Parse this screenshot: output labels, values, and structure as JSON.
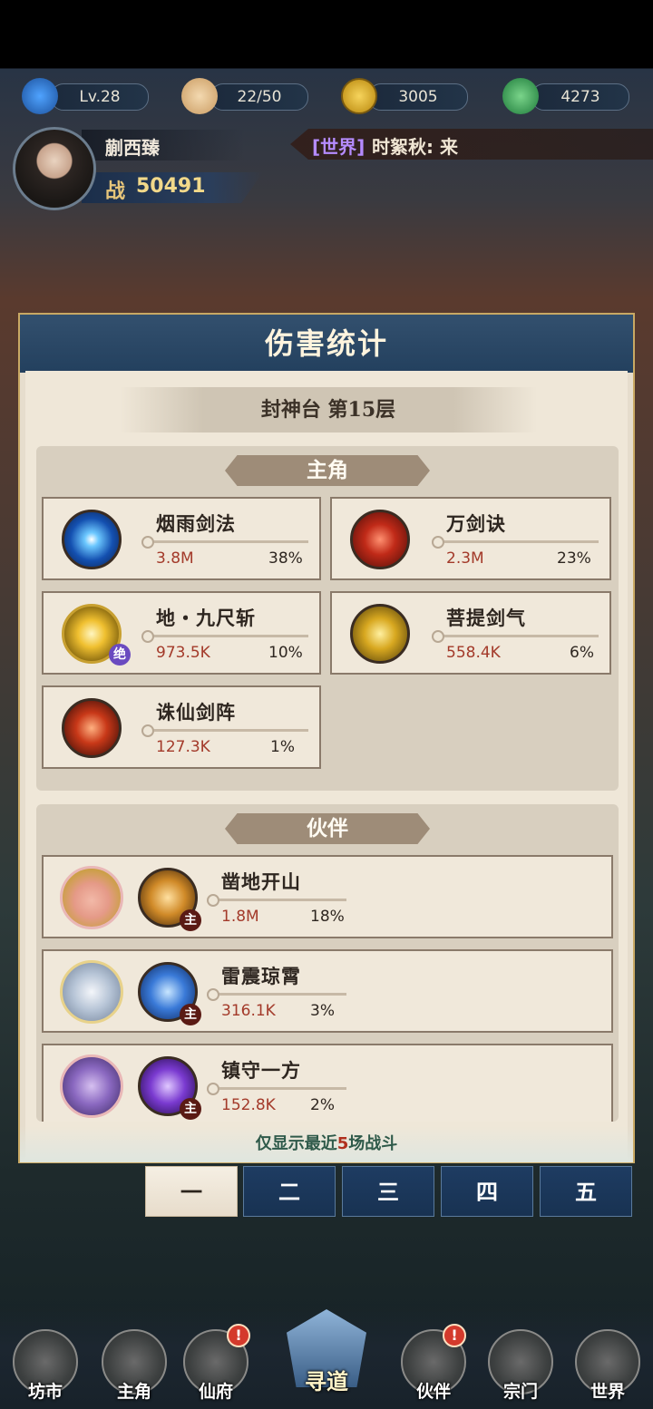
{
  "top_bar": {
    "level": "Lv.28",
    "stamina": "22/50",
    "coins": "3005",
    "jade": "4273"
  },
  "player": {
    "name": "蒯西臻",
    "power_label": "战",
    "power_value": "50491"
  },
  "chat": {
    "channel": "[世界]",
    "message": "时絮秋: 来"
  },
  "panel": {
    "title": "伤害统计",
    "floor": "封神台 第15层",
    "protagonist_header": "主角",
    "partner_header": "伙伴",
    "note_prefix": "仅显示最近",
    "note_num": "5",
    "note_suffix": "场战斗",
    "badge_zhu": "主",
    "badge_jue": "绝"
  },
  "protagonist_skills": [
    {
      "name": "烟雨剑法",
      "damage": "3.8M",
      "percent": "38%"
    },
    {
      "name": "万剑诀",
      "damage": "2.3M",
      "percent": "23%"
    },
    {
      "name": "地・九尺斩",
      "damage": "973.5K",
      "percent": "10%"
    },
    {
      "name": "菩提剑气",
      "damage": "558.4K",
      "percent": "6%"
    },
    {
      "name": "诛仙剑阵",
      "damage": "127.3K",
      "percent": "1%"
    }
  ],
  "partner_skills": [
    {
      "name": "凿地开山",
      "damage": "1.8M",
      "percent": "18%"
    },
    {
      "name": "雷震琼霄",
      "damage": "316.1K",
      "percent": "3%"
    },
    {
      "name": "镇守一方",
      "damage": "152.8K",
      "percent": "2%"
    }
  ],
  "battle_tabs": [
    "一",
    "二",
    "三",
    "四",
    "五"
  ],
  "bottom_nav": [
    "坊市",
    "主角",
    "仙府",
    "寻道",
    "伙伴",
    "宗门",
    "世界"
  ],
  "nav_badge": "!"
}
